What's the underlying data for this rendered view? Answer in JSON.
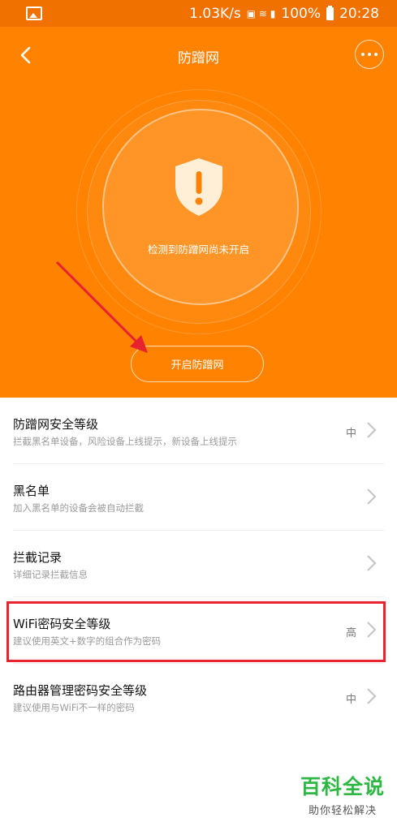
{
  "status_bar": {
    "speed": "1.03K/s",
    "battery": "100%",
    "time": "20:28"
  },
  "header": {
    "title": "防蹭网",
    "status_text": "检测到防蹭网尚未开启",
    "enable_button": "开启防蹭网"
  },
  "settings": [
    {
      "title": "防蹭网安全等级",
      "subtitle": "拦截黑名单设备，风险设备上线提示，新设备上线提示",
      "value": "中"
    },
    {
      "title": "黑名单",
      "subtitle": "加入黑名单的设备会被自动拦截",
      "value": ""
    },
    {
      "title": "拦截记录",
      "subtitle": "详细记录拦截信息",
      "value": ""
    },
    {
      "title": "WiFi密码安全等级",
      "subtitle": "建议使用英文+数字的组合作为密码",
      "value": "高"
    },
    {
      "title": "路由器管理密码安全等级",
      "subtitle": "建议使用与WiFi不一样的密码",
      "value": "中"
    }
  ],
  "watermark": {
    "main": "百科全说",
    "sub": "助你轻松解决"
  },
  "colors": {
    "header_bg": "#ff8200",
    "annotation_red": "#e8232f",
    "watermark_green": "#2eb843"
  },
  "icons": [
    "image-icon",
    "back-icon",
    "more-icon",
    "shield-alert-icon",
    "chevron-right-icon"
  ]
}
